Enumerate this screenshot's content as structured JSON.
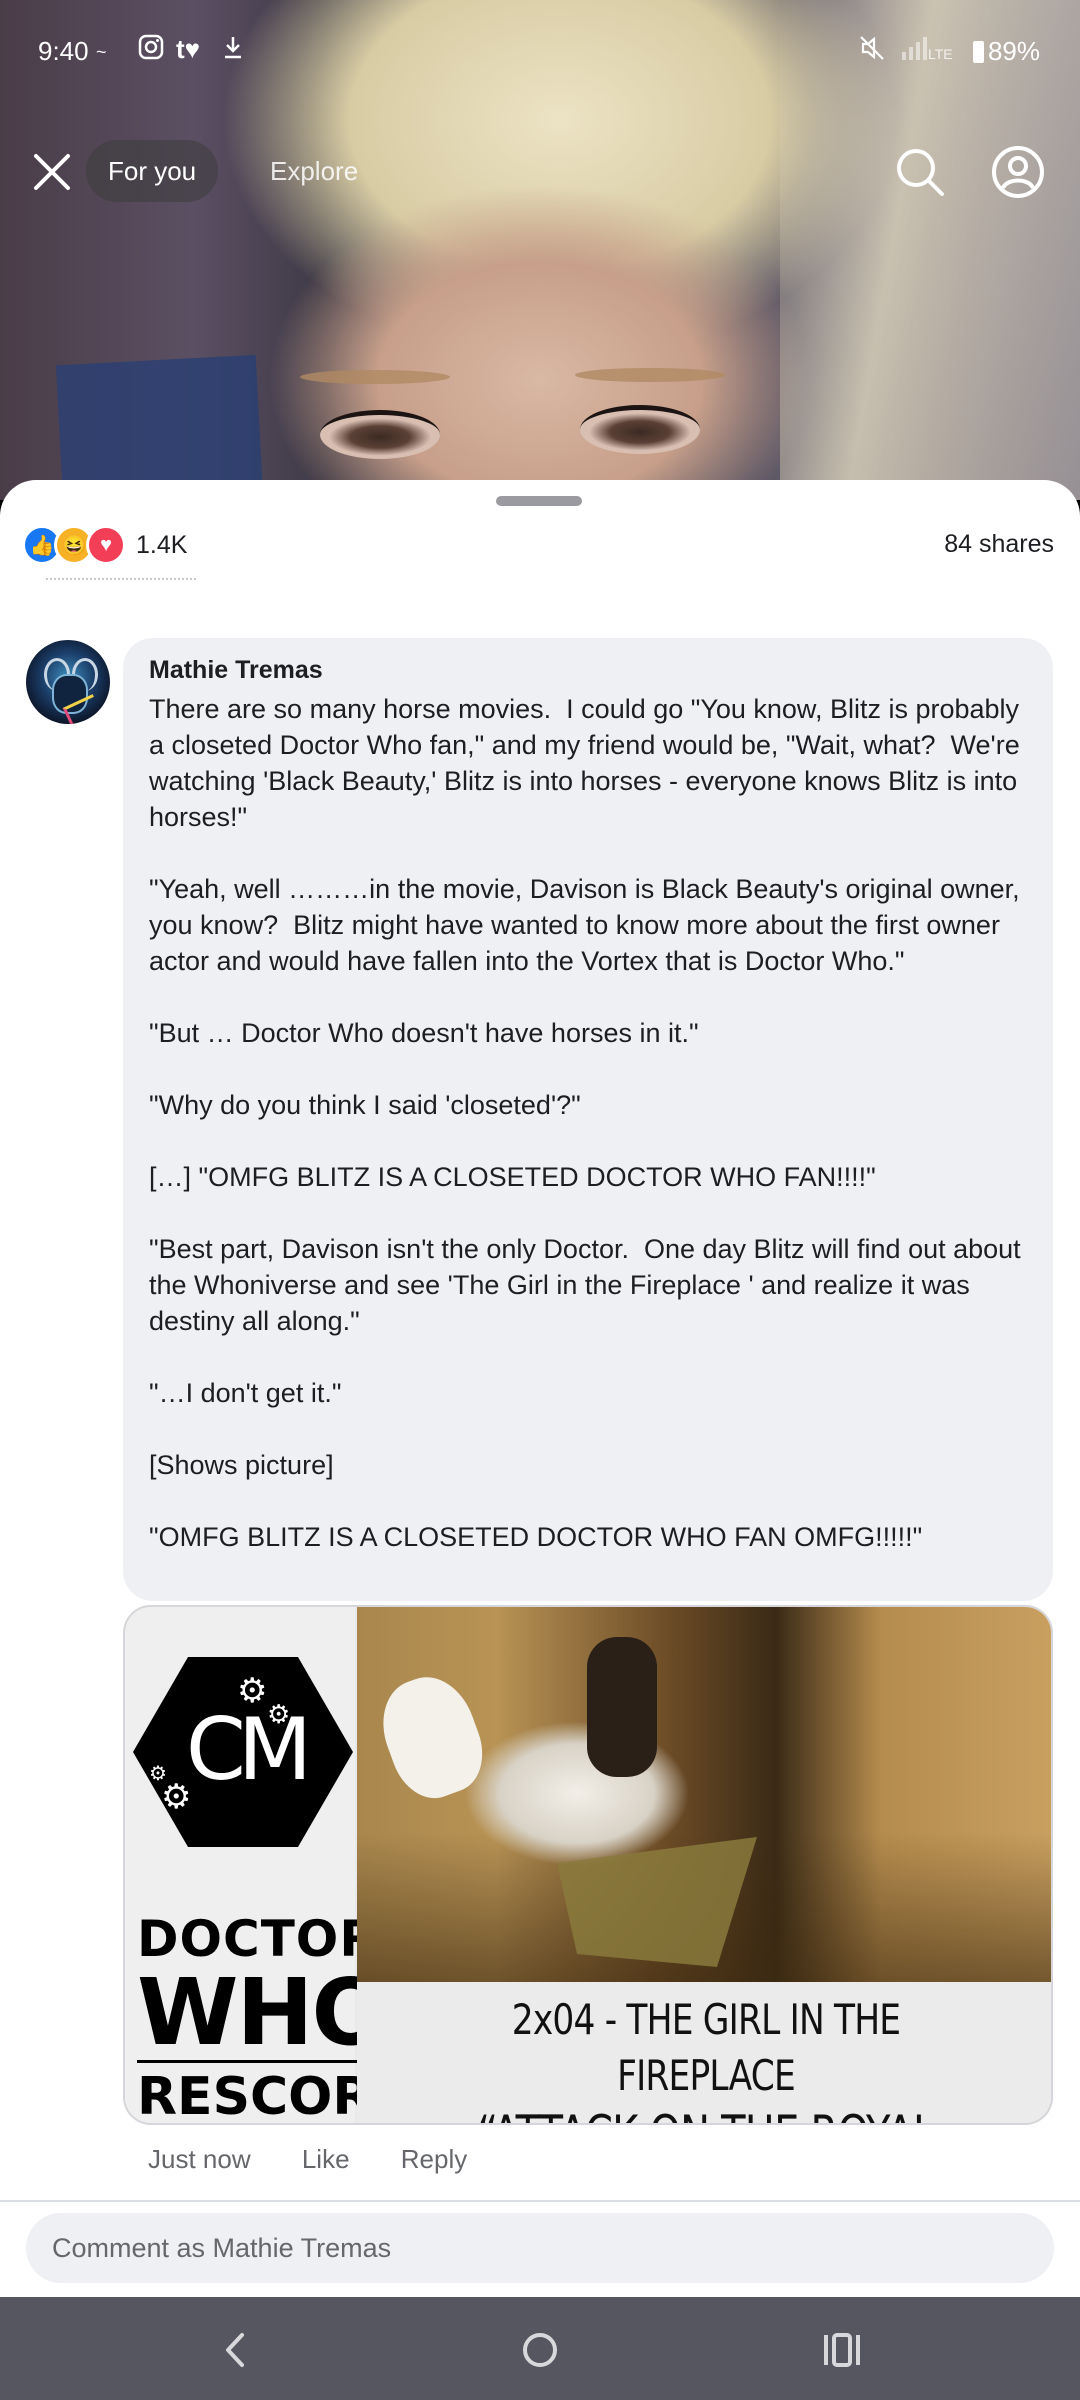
{
  "status_bar": {
    "time": "9:40",
    "battery": "89%",
    "network": "LTE"
  },
  "top_nav": {
    "tabs": [
      {
        "label": "For you",
        "active": true
      },
      {
        "label": "Explore",
        "active": false
      }
    ]
  },
  "post_stats": {
    "reaction_count": "1.4K",
    "shares": "84 shares"
  },
  "comment": {
    "author": "Mathie Tremas",
    "paragraphs": [
      "There are so many horse movies.  I could go \"You know, Blitz is probably a closeted Doctor Who fan,\" and my friend would be, \"Wait, what?  We're watching 'Black Beauty,' Blitz is into horses - everyone knows Blitz is into horses!\"",
      "\"Yeah, well ………in the movie, Davison is Black Beauty's original owner, you know?  Blitz might have wanted to know more about the first owner actor and would have fallen into the Vortex that is Doctor Who.\"",
      "\"But … Doctor Who doesn't have horses in it.\"",
      "\"Why do you think I said 'closeted'?\"",
      "[…] \"OMFG BLITZ IS A CLOSETED DOCTOR WHO FAN!!!!\"",
      "\"Best part, Davison isn't the only Doctor.  One day Blitz will find out about the Whoniverse and see 'The Girl in the Fireplace ' and realize it was destiny all along.\"",
      "\"…I don't get it.\"",
      "[Shows picture]",
      "\"OMFG BLITZ IS A CLOSETED DOCTOR WHO FAN OMFG!!!!!\""
    ],
    "attachment": {
      "logo_text": "CM",
      "title_doctor": "DOCTOR",
      "title_who": "WHO",
      "title_rescored": "RESCORED",
      "caption_line1": "2x04 - THE GIRL IN THE FIREPLACE",
      "caption_line2": "“ATTACK ON THE ROYAL COURT”"
    },
    "actions": {
      "timestamp": "Just now",
      "like": "Like",
      "reply": "Reply"
    }
  },
  "composer": {
    "placeholder": "Comment as Mathie Tremas"
  },
  "colors": {
    "like_blue": "#1877f2",
    "love_red": "#f33e58",
    "haha_yellow": "#f7b125",
    "bubble_bg": "#eff0f4",
    "nav_bar": "#565660"
  },
  "icons": [
    "close-icon",
    "search-icon",
    "profile-icon",
    "like-reaction-icon",
    "haha-reaction-icon",
    "love-reaction-icon",
    "back-icon",
    "home-icon",
    "recents-icon"
  ]
}
